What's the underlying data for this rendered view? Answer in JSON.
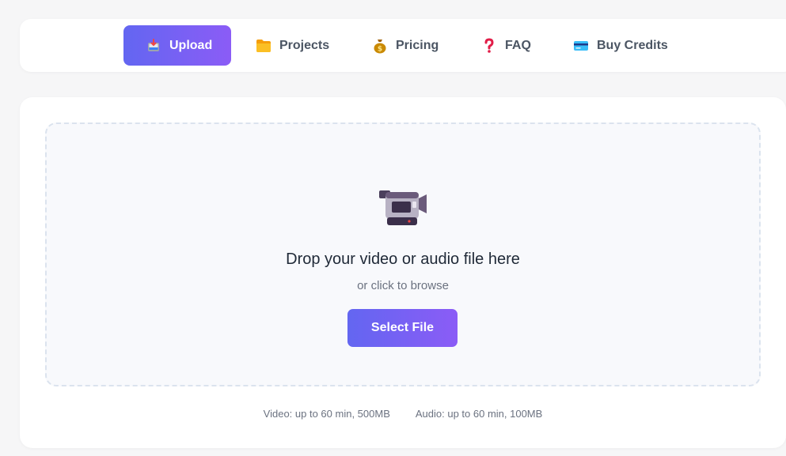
{
  "nav": {
    "items": [
      {
        "label": "Upload",
        "icon": "inbox-tray-icon",
        "active": true
      },
      {
        "label": "Projects",
        "icon": "folder-icon",
        "active": false
      },
      {
        "label": "Pricing",
        "icon": "money-bag-icon",
        "active": false
      },
      {
        "label": "FAQ",
        "icon": "question-mark-icon",
        "active": false
      },
      {
        "label": "Buy Credits",
        "icon": "credit-card-icon",
        "active": false
      }
    ]
  },
  "upload": {
    "icon": "video-camera-icon",
    "title": "Drop your video or audio file here",
    "subtitle": "or click to browse",
    "button_label": "Select File"
  },
  "limits": {
    "video": "Video: up to 60 min, 500MB",
    "audio": "Audio: up to 60 min, 100MB"
  },
  "colors": {
    "accent_start": "#6366f1",
    "accent_end": "#8b5cf6",
    "background": "#f6f6f7"
  }
}
